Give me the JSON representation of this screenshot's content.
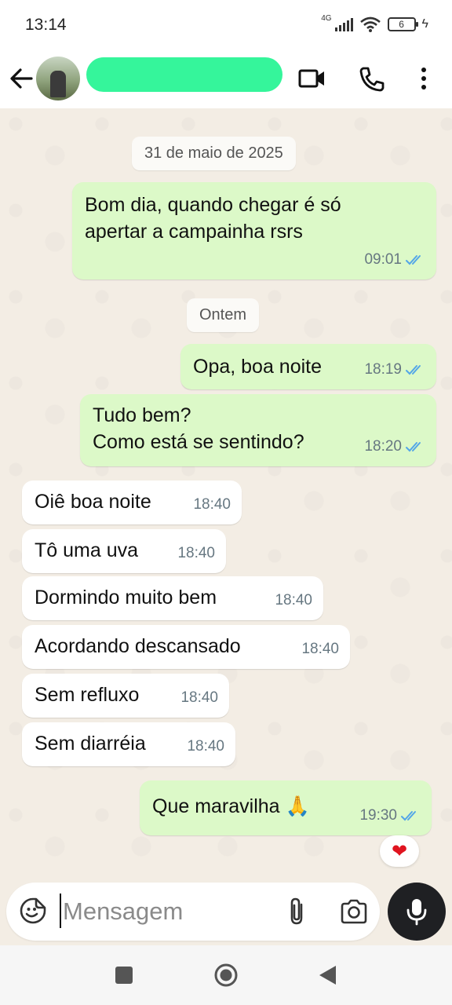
{
  "status_bar": {
    "time": "13:14",
    "network": "4G",
    "battery": "6"
  },
  "header": {
    "contact_name_redacted": true
  },
  "chat": {
    "date_chips": [
      "31 de maio de 2025",
      "Ontem"
    ],
    "messages": [
      {
        "dir": "out",
        "text": "Bom dia, quando chegar é só\napertar a campainha rsrs",
        "time": "09:01",
        "status": "read"
      },
      {
        "dir": "out",
        "text": "Opa, boa noite",
        "time": "18:19",
        "status": "read"
      },
      {
        "dir": "out",
        "text": "Tudo bem?\nComo está se sentindo?",
        "time": "18:20",
        "status": "read"
      },
      {
        "dir": "in",
        "text": "Oiê boa noite",
        "time": "18:40"
      },
      {
        "dir": "in",
        "text": "Tô uma uva",
        "time": "18:40"
      },
      {
        "dir": "in",
        "text": "Dormindo muito bem",
        "time": "18:40"
      },
      {
        "dir": "in",
        "text": "Acordando descansado",
        "time": "18:40"
      },
      {
        "dir": "in",
        "text": "Sem refluxo",
        "time": "18:40"
      },
      {
        "dir": "in",
        "text": "Sem diarréia",
        "time": "18:40"
      },
      {
        "dir": "out",
        "text": "Que maravilha 🙏",
        "time": "19:30",
        "status": "read"
      }
    ],
    "reaction": "❤"
  },
  "composer": {
    "placeholder": "Mensagem"
  },
  "colors": {
    "outgoing_bubble": "#dcf9c8",
    "incoming_bubble": "#ffffff",
    "read_ticks": "#53a6e8",
    "chat_background": "#f3ede4"
  },
  "icons": [
    "back-arrow-icon",
    "video-call-icon",
    "voice-call-icon",
    "more-options-icon",
    "sticker-icon",
    "attach-icon",
    "camera-icon",
    "mic-icon"
  ]
}
